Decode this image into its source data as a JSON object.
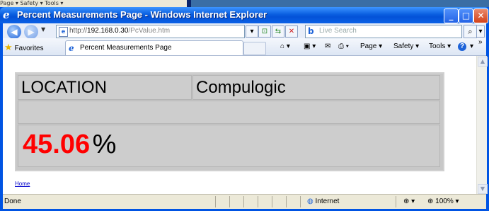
{
  "background_window": {
    "toolbar_text": "Page ▾   Safety ▾   Tools ▾"
  },
  "window": {
    "title": "Percent Measurements Page - Windows Internet Explorer",
    "min": "_",
    "max": "□",
    "close": "✕"
  },
  "navbar": {
    "back": "◀",
    "forward": "▶",
    "url_prefix": "http://",
    "url_host": "192.168.0.30",
    "url_path": "/PcValue.htm",
    "search_placeholder": "Live Search"
  },
  "tabs": {
    "favorites_label": "Favorites",
    "active_tab_label": "Percent Measurements Page"
  },
  "command_bar": {
    "page": "Page ▾",
    "safety": "Safety ▾",
    "tools": "Tools ▾",
    "help": "?",
    "more": "»"
  },
  "content": {
    "location_label": "LOCATION",
    "location_value": "Compulogic",
    "value": "45.06",
    "unit": "%",
    "home_link": "Home"
  },
  "statusbar": {
    "status": "Done",
    "zone": "Internet",
    "zoom": "100%"
  },
  "colors": {
    "value_color": "#ff0000",
    "title_blue": "#0a5fe0"
  }
}
